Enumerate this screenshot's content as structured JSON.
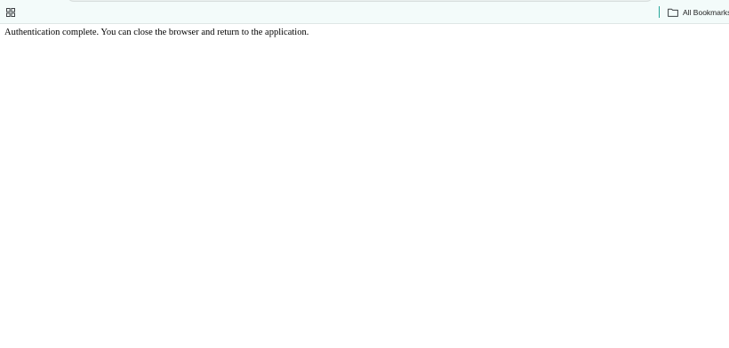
{
  "bookmarks_bar": {
    "apps_icon": "apps-grid-icon",
    "all_bookmarks_icon": "folder-icon",
    "all_bookmarks_label": "All Bookmarks",
    "separator_color": "#26a69a"
  },
  "page": {
    "message": "Authentication complete. You can close the browser and return to the application."
  }
}
